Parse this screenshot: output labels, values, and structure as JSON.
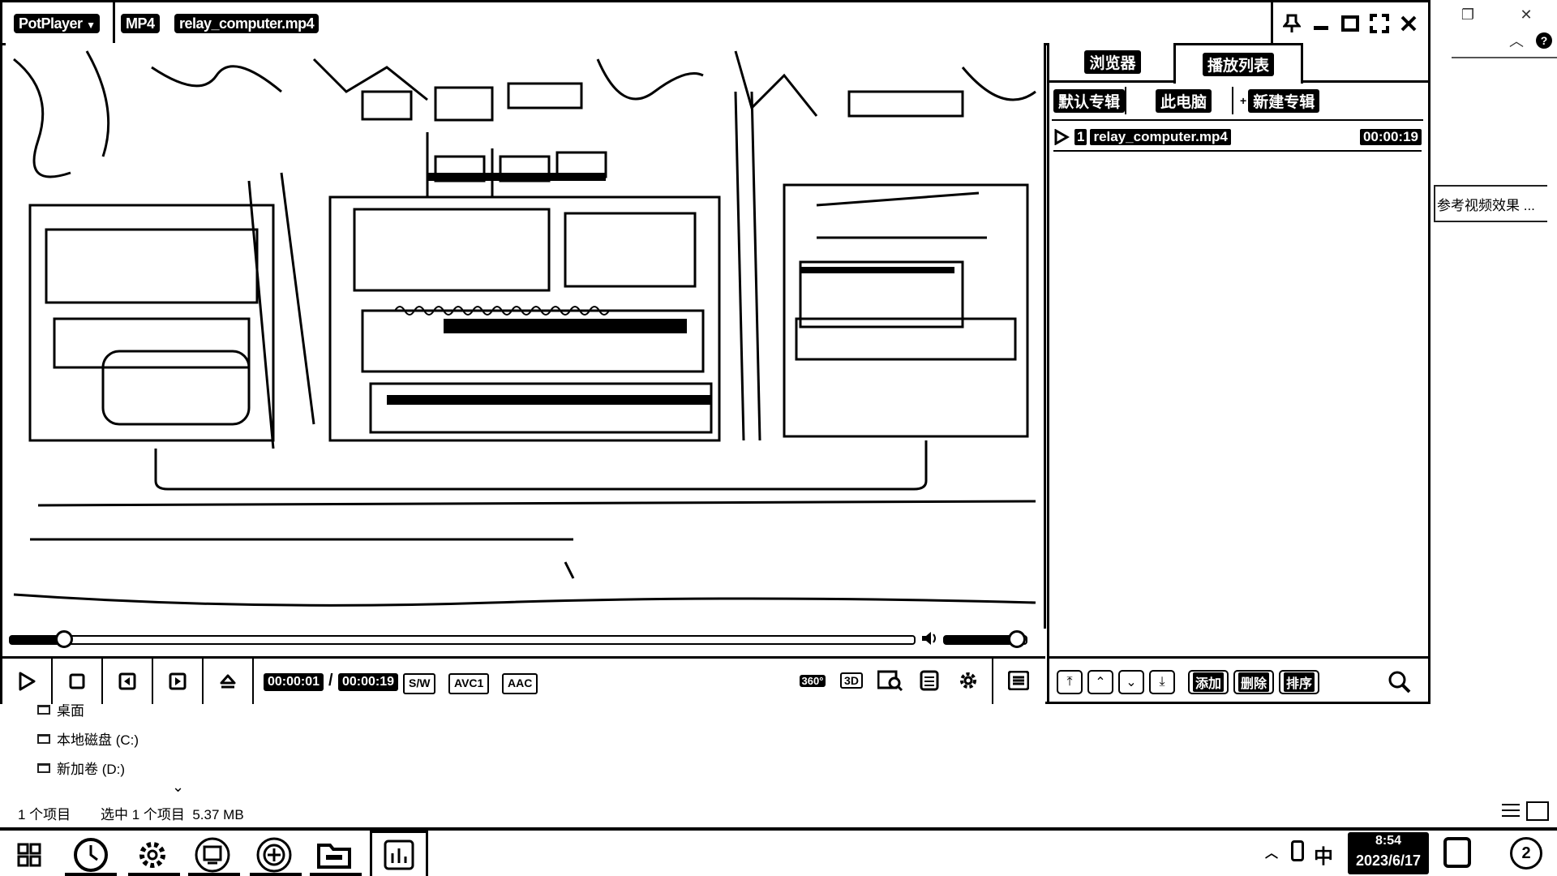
{
  "explorer": {
    "tree_items": [
      {
        "label": "桌面"
      },
      {
        "label": "本地磁盘 (C:)"
      },
      {
        "label": "新加卷 (D:)"
      }
    ],
    "status_count": "1 个项目",
    "status_selected": "选中 1 个项目  5.37 MB",
    "hint_text": "参考视频效果 ..."
  },
  "player": {
    "app_name": "PotPlayer",
    "format_badge": "MP4",
    "file_title": "relay_computer.mp4",
    "progress": 0.06,
    "volume": 0.9,
    "time_current": "00:00:01",
    "time_separator": "/",
    "time_total": "00:00:19",
    "tags": [
      "S/W",
      "AVC1",
      "AAC"
    ],
    "right_icons": [
      "360°",
      "3D"
    ]
  },
  "playlist": {
    "tabs": [
      "浏览器",
      "播放列表"
    ],
    "active_tab": "播放列表",
    "subtabs": [
      "默认专辑",
      "此电脑",
      "新建专辑"
    ],
    "items": [
      {
        "index": "1",
        "name": "relay_computer.mp4",
        "duration": "00:00:19"
      }
    ],
    "buttons": [
      "添加",
      "删除",
      "排序"
    ]
  },
  "taskbar": {
    "ime": "中",
    "time": "8:54",
    "date": "2023/6/17",
    "notification_count": "2"
  }
}
